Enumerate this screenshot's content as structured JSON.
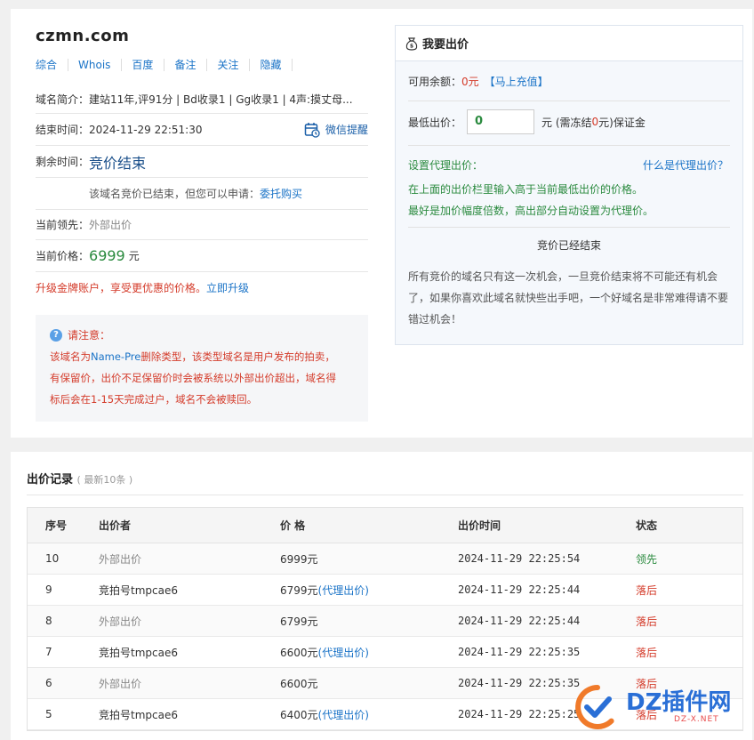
{
  "domain": "czmn.com",
  "links": [
    "综合",
    "Whois",
    "百度",
    "备注",
    "关注",
    "隐藏"
  ],
  "info": {
    "intro_label": "域名简介：",
    "intro_value": "建站11年,评91分 | Bd收录1 | Gg收录1 | 4声:摸丈母...",
    "end_label": "结束时间：",
    "end_value": "2024-11-29 22:51:30",
    "wechat_label": "微信提醒",
    "remain_label": "剩余时间：",
    "remain_value": "竞价结束",
    "ended_msg": "该域名竞价已结束，但您可以申请：",
    "ended_link": "委托购买",
    "leader_label": "当前领先：",
    "leader_value": "外部出价",
    "price_label": "当前价格：",
    "price_value": "6999",
    "price_unit": "元",
    "upgrade_msg": "升级金牌账户，享受更优惠的价格。",
    "upgrade_link": "立即升级"
  },
  "notice": {
    "title": "请注意：",
    "line1_a": "该域名为",
    "line1_hl": "Name-Pre",
    "line1_b": "删除类型，该类型域名是用户发布的拍卖，",
    "line2": "有保留价，出价不足保留价时会被系统以外部出价超出，域名得",
    "line3": "标后会在1-15天完成过户，域名不会被赎回。"
  },
  "bid": {
    "title": "我要出价",
    "balance_label": "可用余额：",
    "balance_value": "0元",
    "recharge": "【马上充值】",
    "min_label": "最低出价：",
    "min_value": "0",
    "freeze_a": "元 (需冻结 ",
    "freeze_value": "0",
    "freeze_b": " 元)保证金",
    "proxy_label": "设置代理出价：",
    "proxy_help": "什么是代理出价？",
    "proxy_line1": "在上面的出价栏里输入高于当前最低出价的价格。",
    "proxy_line2": "最好是加价幅度倍数，高出部分自动设置为代理价。",
    "ended": "竞价已经结束",
    "end_desc": "所有竞价的域名只有这一次机会，一旦竞价结束将不可能还有机会了，如果你喜欢此域名就快些出手吧，一个好域名是非常难得请不要错过机会！"
  },
  "records": {
    "title": "出价记录",
    "subtitle": "( 最新10条 )",
    "headers": [
      "序号",
      "出价者",
      "价 格",
      "出价时间",
      "状态"
    ],
    "rows": [
      {
        "no": "10",
        "bidder": "外部出价",
        "price": "6999元",
        "proxy": "",
        "time": "2024-11-29 22:25:54",
        "status": "领先"
      },
      {
        "no": "9",
        "bidder": "竞拍号tmpcae6",
        "price": "6799元",
        "proxy": "(代理出价)",
        "time": "2024-11-29 22:25:44",
        "status": "落后"
      },
      {
        "no": "8",
        "bidder": "外部出价",
        "price": "6799元",
        "proxy": "",
        "time": "2024-11-29 22:25:44",
        "status": "落后"
      },
      {
        "no": "7",
        "bidder": "竞拍号tmpcae6",
        "price": "6600元",
        "proxy": "(代理出价)",
        "time": "2024-11-29 22:25:35",
        "status": "落后"
      },
      {
        "no": "6",
        "bidder": "外部出价",
        "price": "6600元",
        "proxy": "",
        "time": "2024-11-29 22:25:35",
        "status": "落后"
      },
      {
        "no": "5",
        "bidder": "竞拍号tmpcae6",
        "price": "6400元",
        "proxy": "(代理出价)",
        "time": "2024-11-29 22:25:25",
        "status": "落后"
      }
    ]
  },
  "watermark": {
    "main": "DZ插件网",
    "sub": "DZ-X.NET"
  }
}
